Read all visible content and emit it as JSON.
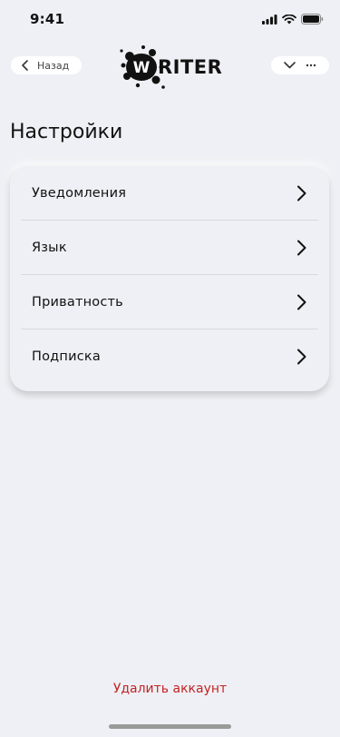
{
  "status": {
    "time": "9:41"
  },
  "nav": {
    "back_label": "Назад",
    "logo_text": "WRITER"
  },
  "page": {
    "title": "Настройки"
  },
  "settings": {
    "items": [
      {
        "label": "Уведомления"
      },
      {
        "label": "Язык"
      },
      {
        "label": "Приватность"
      },
      {
        "label": "Подписка"
      }
    ]
  },
  "footer": {
    "delete_label": "Удалить аккаунт"
  },
  "colors": {
    "background": "#eff0f5",
    "danger": "#c12424"
  },
  "icons": [
    "signal-icon",
    "wifi-icon",
    "battery-icon",
    "chevron-left-icon",
    "chevron-down-icon",
    "more-icon",
    "chevron-right-icon"
  ]
}
